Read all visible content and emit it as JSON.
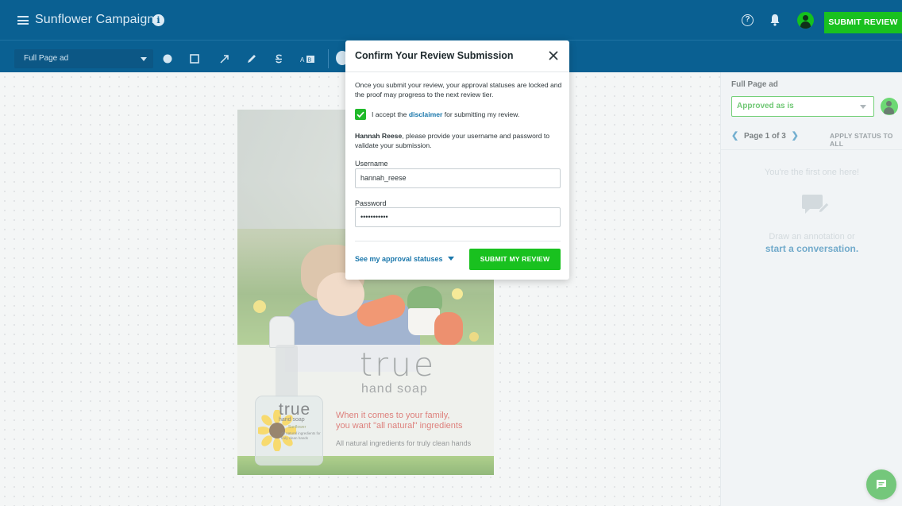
{
  "app": {
    "project_title": "Sunflower Campaign",
    "submit_review_label": "SUBMIT REVIEW"
  },
  "toolbar": {
    "page_select_value": "Full Page ad",
    "tools": [
      "circle-tool-icon",
      "rectangle-tool-icon",
      "arrow-tool-icon",
      "pen-tool-icon",
      "strikethrough-tool-icon",
      "replace-text-tool-icon"
    ]
  },
  "proof": {
    "brand": "true",
    "brand_sub": "hand soap",
    "tagline_1": "When it comes to your family,",
    "tagline_2": "you want \"all natural\" ingredients",
    "subline": "All natural ingredients for truly clean hands",
    "bottle_brand": "true",
    "bottle_sub": "hand soap",
    "bottle_variant": "Sunflower",
    "bottle_ingredients": "All natural ingredients for truly clean hands"
  },
  "panel": {
    "title": "Full Page ad",
    "status_value": "Approved as is",
    "page_indicator": "Page 1 of 3",
    "apply_all_label": "APPLY STATUS TO ALL",
    "empty_title": "You're the first one here!",
    "empty_hint": "Draw an annotation or",
    "start_conversation": "start a conversation."
  },
  "modal": {
    "title": "Confirm Your Review Submission",
    "description": "Once you submit your review, your approval statuses are locked and the proof may progress to the next review tier.",
    "accept_prefix": "I accept the",
    "accept_link": "disclaimer",
    "accept_suffix": "for submitting my review.",
    "accept_checked": true,
    "reviewer_name": "Hannah Reese",
    "validate_text": ", please provide your username and password to validate your submission.",
    "username_label": "Username",
    "username_value": "hannah_reese",
    "password_label": "Password",
    "password_value": "•••••••••••",
    "approval_statuses_link": "See my approval statuses",
    "submit_label": "SUBMIT MY REVIEW"
  },
  "colors": {
    "header": "#0a6092",
    "accent_green": "#19c11f",
    "link_blue": "#1a77ab",
    "tagline_red": "#c8312b"
  }
}
